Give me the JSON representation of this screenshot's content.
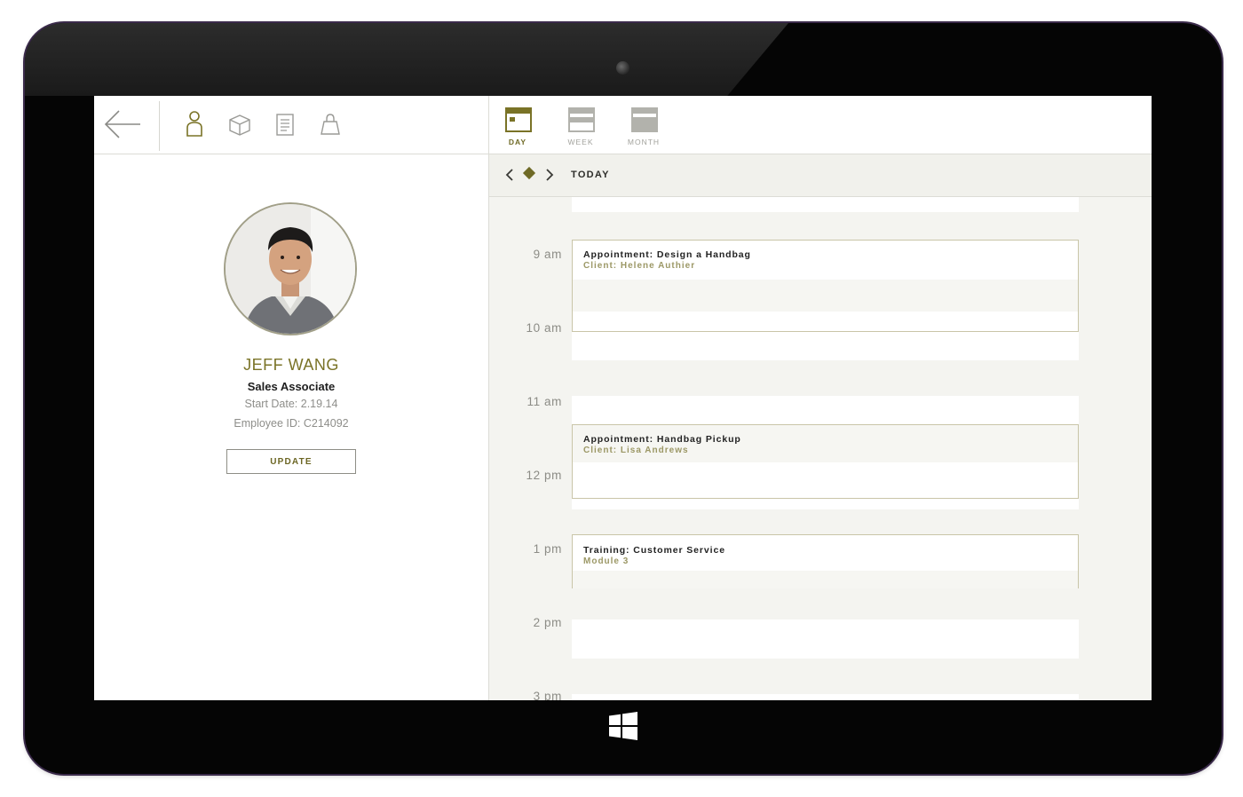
{
  "profile": {
    "name": "JEFF WANG",
    "role": "Sales Associate",
    "start_date": "Start Date: 2.19.14",
    "employee_id": "Employee ID: C214092",
    "update_label": "UPDATE"
  },
  "toolbar": {
    "icons": [
      "back-arrow-icon",
      "person-icon",
      "box-icon",
      "document-icon",
      "shopping-bag-icon"
    ]
  },
  "views": {
    "day": "DAY",
    "week": "WEEK",
    "month": "MONTH",
    "active": "DAY"
  },
  "nav": {
    "today": "TODAY"
  },
  "hours": [
    "9 am",
    "10 am",
    "11 am",
    "12 pm",
    "1 pm",
    "2 pm",
    "3 pm"
  ],
  "events": [
    {
      "title": "Appointment: Design a Handbag",
      "subtitle": "Client: Helene Authier"
    },
    {
      "title": "Appointment: Handbag Pickup",
      "subtitle": "Client: Lisa Andrews"
    },
    {
      "title": "Training: Customer Service",
      "subtitle": "Module 3"
    }
  ],
  "colors": {
    "accent": "#7a7327",
    "accent_muted": "#9c9866",
    "bezel": "#050505",
    "background_panel": "#f4f4f0"
  }
}
